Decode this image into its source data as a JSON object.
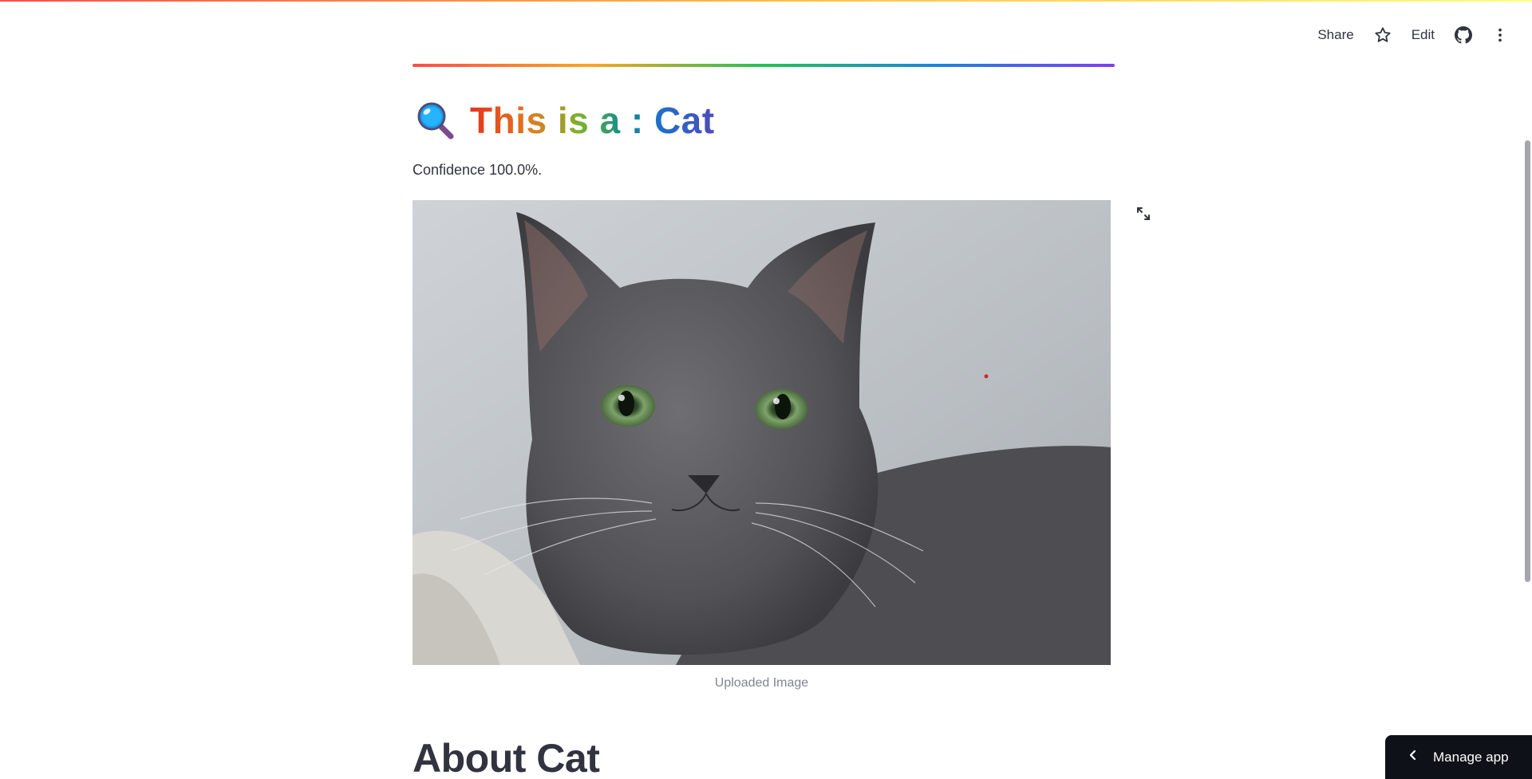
{
  "header": {
    "share_label": "Share",
    "edit_label": "Edit",
    "star_icon": "star-icon",
    "github_icon": "github-icon",
    "menu_icon": "kebab-menu-icon"
  },
  "main": {
    "title": {
      "icon": "magnifier-icon",
      "text": "This is a : Cat"
    },
    "confidence_text": "Confidence 100.0%.",
    "image": {
      "alt": "cat-photo",
      "caption": "Uploaded Image",
      "fullscreen_icon": "expand-icon"
    },
    "section_heading": "About Cat"
  },
  "footer": {
    "manage_app_label": "Manage app",
    "chevron_icon": "chevron-left-icon"
  },
  "colors": {
    "accent": "#ff4b4b",
    "text": "#31333f",
    "caption": "#808495",
    "manage_bg": "#0e1117"
  }
}
